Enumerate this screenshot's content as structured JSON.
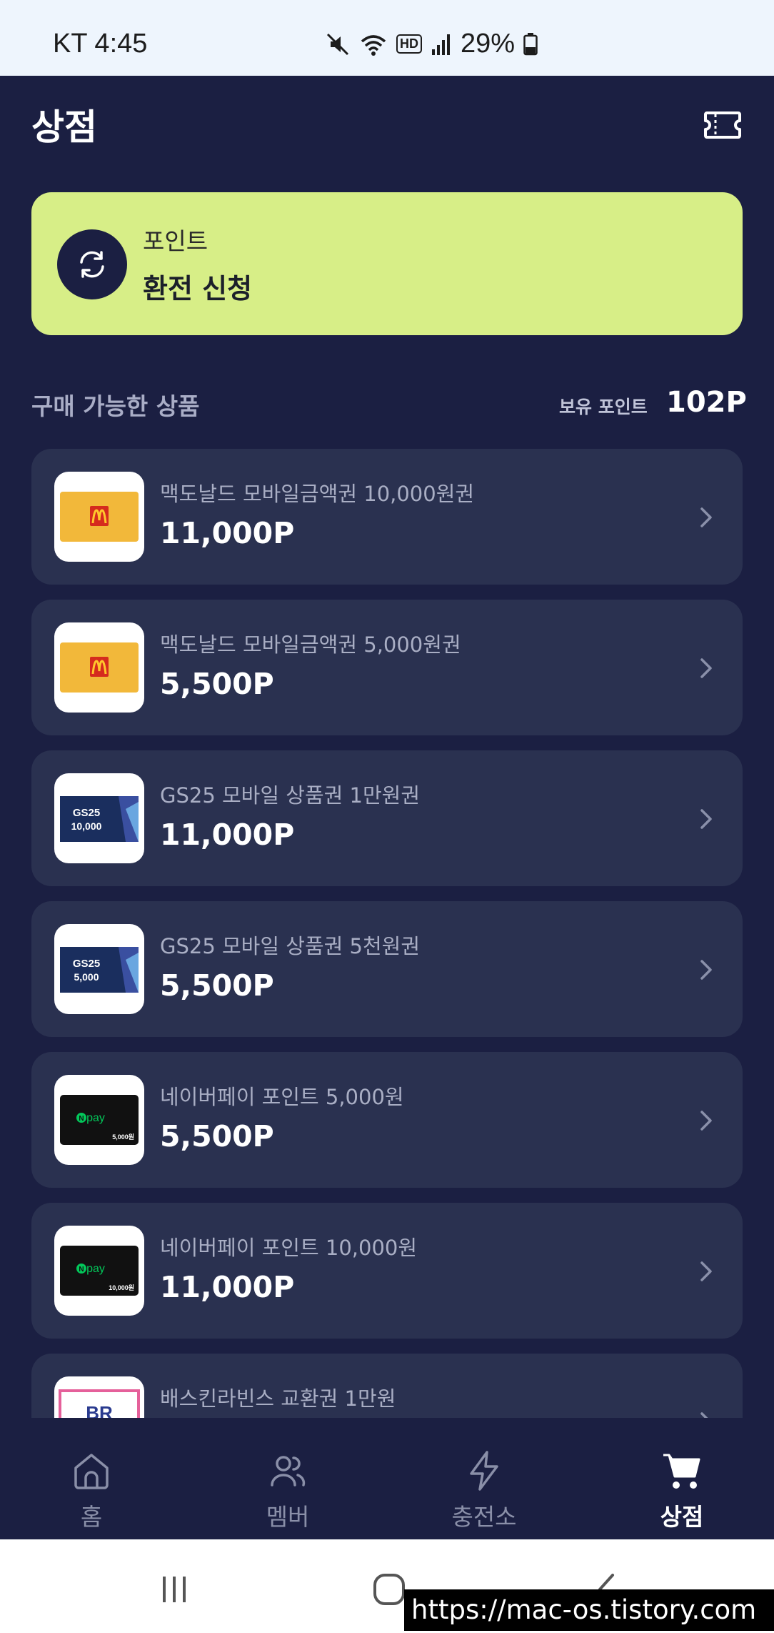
{
  "status_bar": {
    "carrier_time": "KT 4:45",
    "hd_label": "HD",
    "battery_pct": "29%"
  },
  "header": {
    "title": "상점",
    "ticket_icon": "ticket-icon"
  },
  "exchange_card": {
    "subtitle": "포인트",
    "title": "환전 신청",
    "icon": "refresh-icon",
    "background": "#d7ee87"
  },
  "section": {
    "title": "구매 가능한 상품",
    "points_label": "보유 포인트",
    "points_value": "102P"
  },
  "products": [
    {
      "name": "맥도날드 모바일금액권 10,000원권",
      "price": "11,000P",
      "thumb": "mcdonalds"
    },
    {
      "name": "맥도날드 모바일금액권 5,000원권",
      "price": "5,500P",
      "thumb": "mcdonalds"
    },
    {
      "name": "GS25 모바일 상품권 1만원권",
      "price": "11,000P",
      "thumb": "gs25",
      "thumb_amount": "10,000"
    },
    {
      "name": "GS25 모바일 상품권 5천원권",
      "price": "5,500P",
      "thumb": "gs25",
      "thumb_amount": "5,000"
    },
    {
      "name": "네이버페이 포인트 5,000원",
      "price": "5,500P",
      "thumb": "npay",
      "thumb_amount": "5,000원"
    },
    {
      "name": "네이버페이 포인트 10,000원",
      "price": "11,000P",
      "thumb": "npay",
      "thumb_amount": "10,000원"
    },
    {
      "name": "배스킨라빈스 교환권 1만원",
      "price": "",
      "thumb": "br"
    }
  ],
  "thumb_texts": {
    "gs25_brand": "GS25",
    "npay_brand": "pay",
    "br_brand": "BR"
  },
  "bottom_nav": [
    {
      "label": "홈",
      "icon": "home-icon",
      "active": false
    },
    {
      "label": "멤버",
      "icon": "members-icon",
      "active": false
    },
    {
      "label": "충전소",
      "icon": "lightning-icon",
      "active": false
    },
    {
      "label": "상점",
      "icon": "cart-icon",
      "active": true
    }
  ],
  "watermark": "https://mac-os.tistory.com",
  "colors": {
    "app_bg": "#1b1f42",
    "card_bg": "#2a3150",
    "accent": "#d7ee87"
  }
}
